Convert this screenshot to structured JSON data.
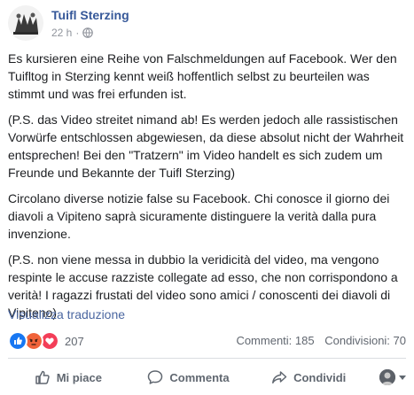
{
  "post": {
    "page_name": "Tuifl Sterzing",
    "time": "22 h",
    "separator": "·",
    "paragraphs": [
      "Es kursieren eine Reihe von Falschmeldungen auf Facebook. Wer den Tuifltog in Sterzing kennt weiß hoffentlich selbst zu beurteilen was stimmt und was frei erfunden ist.",
      "(P.S. das Video streitet nimand ab! Es werden jedoch alle rassistischen Vorwürfe entschlossen abgewiesen, da diese absolut nicht der Wahrheit entsprechen! Bei den \"Tratzern\" im Video handelt es sich zudem um Freunde und Bekannte der Tuifl Sterzing)",
      "Circolano diverse notizie false su Facebook. Chi conosce il giorno dei diavoli a Vipiteno saprà sicuramente distinguere la verità dalla pura invenzione.",
      "(P.S. non viene messa in dubbio la veridicità del video, ma vengono respinte le accuse razziste collegate ad esso, che non corrispondono a verità! I ragazzi frustati del video sono amici / conoscenti dei diavoli di Vipiteno)"
    ],
    "translate_link": "Visualizza traduzione"
  },
  "stats": {
    "reaction_count": "207",
    "comments": "Commenti: 185",
    "shares": "Condivisioni: 70",
    "reaction_icons": [
      "like-icon",
      "angry-icon",
      "love-icon"
    ]
  },
  "actions": {
    "like_label": "Mi piace",
    "comment_label": "Commenta",
    "share_label": "Condividi"
  },
  "colors": {
    "link_blue": "#365899",
    "like_blue": "#1877f2",
    "angry_orange": "#f0633a",
    "love_red": "#f33e58",
    "muted_text": "#616770"
  }
}
